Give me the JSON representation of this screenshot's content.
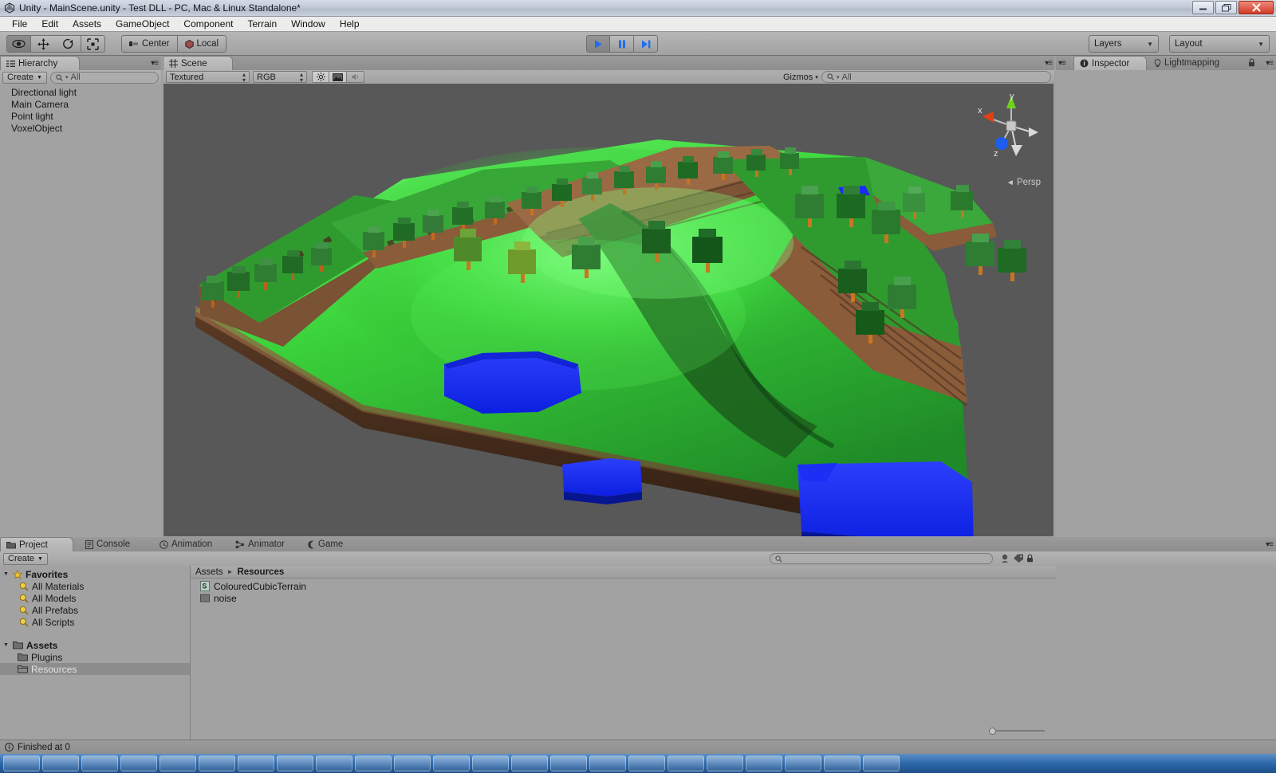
{
  "window": {
    "title": "Unity - MainScene.unity - Test DLL - PC, Mac & Linux Standalone*",
    "app_icon": "unity-icon",
    "minimize_label": "–",
    "maximize_label": "❐",
    "close_label": "✕"
  },
  "menubar": {
    "items": [
      {
        "label": "File"
      },
      {
        "label": "Edit"
      },
      {
        "label": "Assets"
      },
      {
        "label": "GameObject"
      },
      {
        "label": "Component"
      },
      {
        "label": "Terrain"
      },
      {
        "label": "Window"
      },
      {
        "label": "Help"
      }
    ]
  },
  "toolbar": {
    "transform_tools": [
      {
        "name": "hand-tool",
        "icon": "eye-icon",
        "active": true
      },
      {
        "name": "move-tool",
        "icon": "move-arrows-icon",
        "active": false
      },
      {
        "name": "rotate-tool",
        "icon": "rotate-icon",
        "active": false
      },
      {
        "name": "scale-tool",
        "icon": "scale-icon",
        "active": false
      }
    ],
    "pivot_mode": "Center",
    "pivot_rotation": "Local",
    "play": "play-icon",
    "pause": "pause-icon",
    "step": "step-icon",
    "layers_label": "Layers",
    "layout_label": "Layout"
  },
  "hierarchy": {
    "tab_label": "Hierarchy",
    "create_label": "Create",
    "search_placeholder": "All",
    "items": [
      {
        "label": "Directional light"
      },
      {
        "label": "Main Camera"
      },
      {
        "label": "Point light"
      },
      {
        "label": "VoxelObject"
      }
    ]
  },
  "scene": {
    "tab_label": "Scene",
    "draw_mode": "Textured",
    "render_mode": "RGB",
    "lighting_toggle": "sun-icon",
    "skybox_toggle": "image-icon",
    "audio_toggle": "speaker-icon",
    "gizmos_label": "Gizmos",
    "search_placeholder": "All",
    "projection_label": "Persp",
    "axis_x": "x",
    "axis_y": "y",
    "axis_z": "z",
    "background_color": "#585858",
    "grass_color": "#2fa32f",
    "dirt_color": "#8a5d3b",
    "water_color": "#1830f0",
    "tree_color": "#1d7a1d"
  },
  "inspector": {
    "tab_label": "Inspector",
    "tab2_label": "Lightmapping",
    "lock_icon": "lock-icon"
  },
  "project": {
    "tabs": [
      {
        "label": "Project",
        "icon": "folder-icon",
        "active": true
      },
      {
        "label": "Console",
        "icon": "console-icon",
        "active": false
      },
      {
        "label": "Animation",
        "icon": "clock-icon",
        "active": false
      },
      {
        "label": "Animator",
        "icon": "animator-icon",
        "active": false
      },
      {
        "label": "Game",
        "icon": "gamepad-icon",
        "active": false
      }
    ],
    "create_label": "Create",
    "search_placeholder": "",
    "tree": [
      {
        "label": "Favorites",
        "depth": 0,
        "icon": "star-icon",
        "bold": true,
        "expanded": true,
        "selected": false
      },
      {
        "label": "All Materials",
        "depth": 1,
        "icon": "search-icon",
        "bold": false,
        "expanded": null,
        "selected": false
      },
      {
        "label": "All Models",
        "depth": 1,
        "icon": "search-icon",
        "bold": false,
        "expanded": null,
        "selected": false
      },
      {
        "label": "All Prefabs",
        "depth": 1,
        "icon": "search-icon",
        "bold": false,
        "expanded": null,
        "selected": false
      },
      {
        "label": "All Scripts",
        "depth": 1,
        "icon": "search-icon",
        "bold": false,
        "expanded": null,
        "selected": false
      },
      {
        "label": "Assets",
        "depth": 0,
        "icon": "folder-icon",
        "bold": true,
        "expanded": true,
        "selected": false
      },
      {
        "label": "Plugins",
        "depth": 1,
        "icon": "folder-icon",
        "bold": false,
        "expanded": null,
        "selected": false
      },
      {
        "label": "Resources",
        "depth": 1,
        "icon": "folder-open-icon",
        "bold": false,
        "expanded": null,
        "selected": true
      }
    ],
    "breadcrumb": [
      {
        "label": "Assets",
        "current": false
      },
      {
        "label": "Resources",
        "current": true
      }
    ],
    "assets": [
      {
        "label": "ColouredCubicTerrain",
        "icon": "script-icon"
      },
      {
        "label": "noise",
        "icon": "texture-icon"
      }
    ]
  },
  "statusbar": {
    "icon": "info-icon",
    "message": "Finished at 0"
  },
  "taskbar": {
    "items": [
      {
        "name": "taskitem-1"
      },
      {
        "name": "taskitem-2"
      },
      {
        "name": "taskitem-3"
      },
      {
        "name": "taskitem-4"
      },
      {
        "name": "taskitem-5"
      },
      {
        "name": "taskitem-6"
      },
      {
        "name": "taskitem-7"
      },
      {
        "name": "taskitem-8"
      },
      {
        "name": "taskitem-9"
      },
      {
        "name": "taskitem-10"
      },
      {
        "name": "taskitem-11"
      },
      {
        "name": "taskitem-12"
      },
      {
        "name": "taskitem-13"
      },
      {
        "name": "taskitem-14"
      },
      {
        "name": "taskitem-15"
      },
      {
        "name": "taskitem-16"
      },
      {
        "name": "taskitem-17"
      },
      {
        "name": "taskitem-18"
      },
      {
        "name": "taskitem-19"
      },
      {
        "name": "taskitem-20"
      },
      {
        "name": "taskitem-21"
      },
      {
        "name": "taskitem-22"
      },
      {
        "name": "taskitem-23"
      }
    ]
  }
}
